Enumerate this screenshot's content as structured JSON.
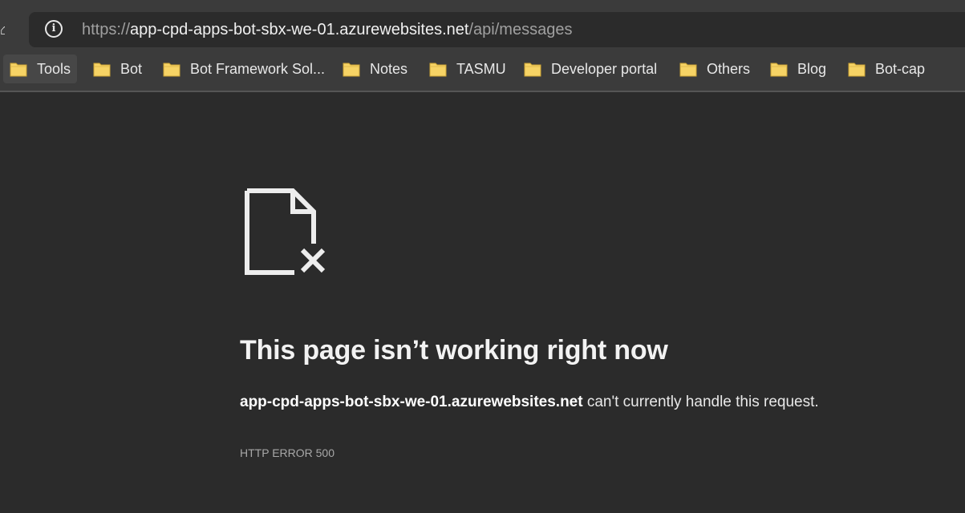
{
  "browser": {
    "address_bar": {
      "url_scheme": "https://",
      "url_host": "app-cpd-apps-bot-sbx-we-01.azurewebsites.net",
      "url_path": "/api/messages",
      "info_icon": "info-circle-icon"
    },
    "bookmarks": [
      {
        "label": "Tools",
        "icon": "folder-icon"
      },
      {
        "label": "Bot",
        "icon": "folder-icon"
      },
      {
        "label": "Bot Framework Sol...",
        "icon": "folder-icon"
      },
      {
        "label": "Notes",
        "icon": "folder-icon"
      },
      {
        "label": "TASMU",
        "icon": "folder-icon"
      },
      {
        "label": "Developer portal",
        "icon": "folder-icon"
      },
      {
        "label": "Others",
        "icon": "folder-icon"
      },
      {
        "label": "Blog",
        "icon": "folder-icon"
      },
      {
        "label": "Bot-cap",
        "icon": "folder-icon"
      }
    ]
  },
  "error_page": {
    "icon": "broken-document-icon",
    "title": "This page isn’t working right now",
    "host": "app-cpd-apps-bot-sbx-we-01.azurewebsites.net",
    "message_suffix": " can't currently handle this request.",
    "error_code": "HTTP ERROR 500"
  },
  "colors": {
    "background": "#2b2b2b",
    "chrome": "#3b3b3b",
    "folder": "#f6d365",
    "text": "#e8e8e8"
  }
}
